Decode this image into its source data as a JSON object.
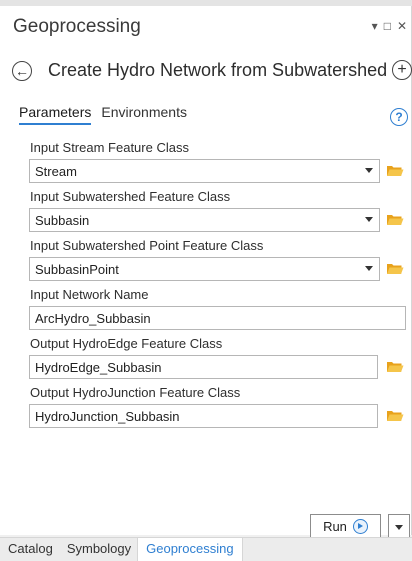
{
  "pane": {
    "title": "Geoprocessing",
    "controls": {
      "menu": "▾",
      "maximize": "□",
      "close": "✕"
    }
  },
  "tool": {
    "back_glyph": "←",
    "title": "Create Hydro Network from Subwatershed",
    "add_glyph": "+"
  },
  "tabs": {
    "parameters": "Parameters",
    "environments": "Environments",
    "help": "?"
  },
  "params": {
    "stream_label": "Input Stream Feature Class",
    "stream_value": "Stream",
    "subwatershed_label": "Input Subwatershed Feature Class",
    "subwatershed_value": "Subbasin",
    "subwatershed_point_label": "Input Subwatershed Point Feature Class",
    "subwatershed_point_value": "SubbasinPoint",
    "network_name_label": "Input Network Name",
    "network_name_value": "ArcHydro_Subbasin",
    "hydroedge_label": "Output HydroEdge Feature Class",
    "hydroedge_value": "HydroEdge_Subbasin",
    "hydrojunction_label": "Output HydroJunction Feature Class",
    "hydrojunction_value": "HydroJunction_Subbasin"
  },
  "run": {
    "label": "Run"
  },
  "bottom_tabs": {
    "catalog": "Catalog",
    "symbology": "Symbology",
    "geoprocessing": "Geoprocessing"
  },
  "icons": {
    "folder": "folder-open-icon",
    "folder_color": "#f0b429",
    "accent": "#2f7fd1"
  }
}
